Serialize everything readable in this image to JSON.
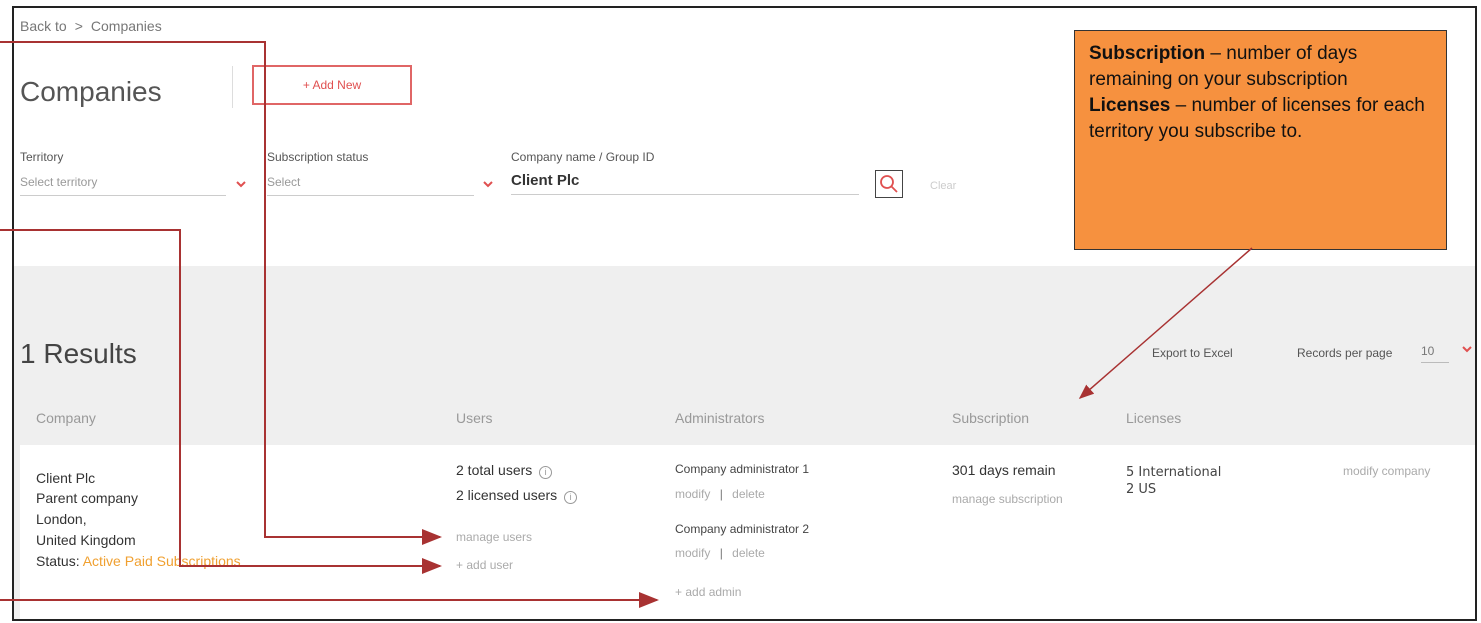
{
  "breadcrumb": {
    "back": "Back to",
    "separator": ">",
    "current": "Companies"
  },
  "page_title": "Companies",
  "add_new_label": "+ Add New",
  "filters": {
    "territory": {
      "label": "Territory",
      "placeholder": "Select territory"
    },
    "subscription_status": {
      "label": "Subscription status",
      "placeholder": "Select"
    },
    "company_name": {
      "label": "Company name / Group ID",
      "value": "Client Plc"
    },
    "clear_label": "Clear"
  },
  "results": {
    "count_label": "1 Results",
    "export_label": "Export to Excel",
    "records_per_page_label": "Records per page",
    "records_per_page_value": "10"
  },
  "table": {
    "headers": [
      "Company",
      "Users",
      "Administrators",
      "Subscription",
      "Licenses"
    ],
    "row": {
      "company_name": "Client Plc",
      "company_type": "Parent company",
      "city": "London,",
      "country": "United Kingdom",
      "status_label": "Status:",
      "status_value": "Active Paid Subscriptions",
      "total_users": "2 total users",
      "licensed_users": "2 licensed users",
      "manage_users": "manage users",
      "add_user": "+ add user",
      "admins": [
        {
          "name": "Company administrator 1",
          "modify": "modify",
          "sep": "|",
          "delete": "delete"
        },
        {
          "name": "Company administrator 2",
          "modify": "modify",
          "sep": "|",
          "delete": "delete"
        }
      ],
      "add_admin": "+ add admin",
      "subscription_remaining": "301 days remain",
      "manage_subscription": "manage subscription",
      "licenses": [
        "5 International",
        "2 US"
      ],
      "modify_company": "modify company"
    }
  },
  "callout": {
    "subscription_term": "Subscription",
    "subscription_desc": " – number of days remaining on your subscription",
    "licenses_term": "Licenses",
    "licenses_desc": " – number of licenses for each territory you subscribe to."
  },
  "colors": {
    "accent": "#e05050",
    "status": "#f0a030",
    "callout_bg": "#f6913f",
    "arrow": "#a83232"
  }
}
